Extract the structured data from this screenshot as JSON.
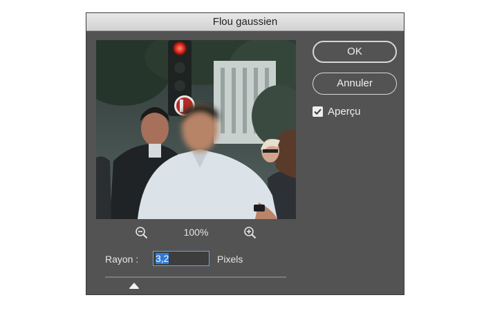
{
  "dialog": {
    "title": "Flou gaussien"
  },
  "buttons": {
    "ok_label": "OK",
    "cancel_label": "Annuler"
  },
  "preview_toggle": {
    "label": "Aperçu",
    "checked": true
  },
  "zoom": {
    "level": "100%",
    "zoom_out_icon": "zoom-out-icon",
    "zoom_in_icon": "zoom-in-icon"
  },
  "radius": {
    "label": "Rayon :",
    "value": "3,2",
    "unit": "Pixels",
    "slider_fraction": 0.16
  },
  "colors": {
    "dialog_bg": "#535353",
    "input_focus": "#6aa3ee",
    "selection": "#2f7bd9"
  }
}
